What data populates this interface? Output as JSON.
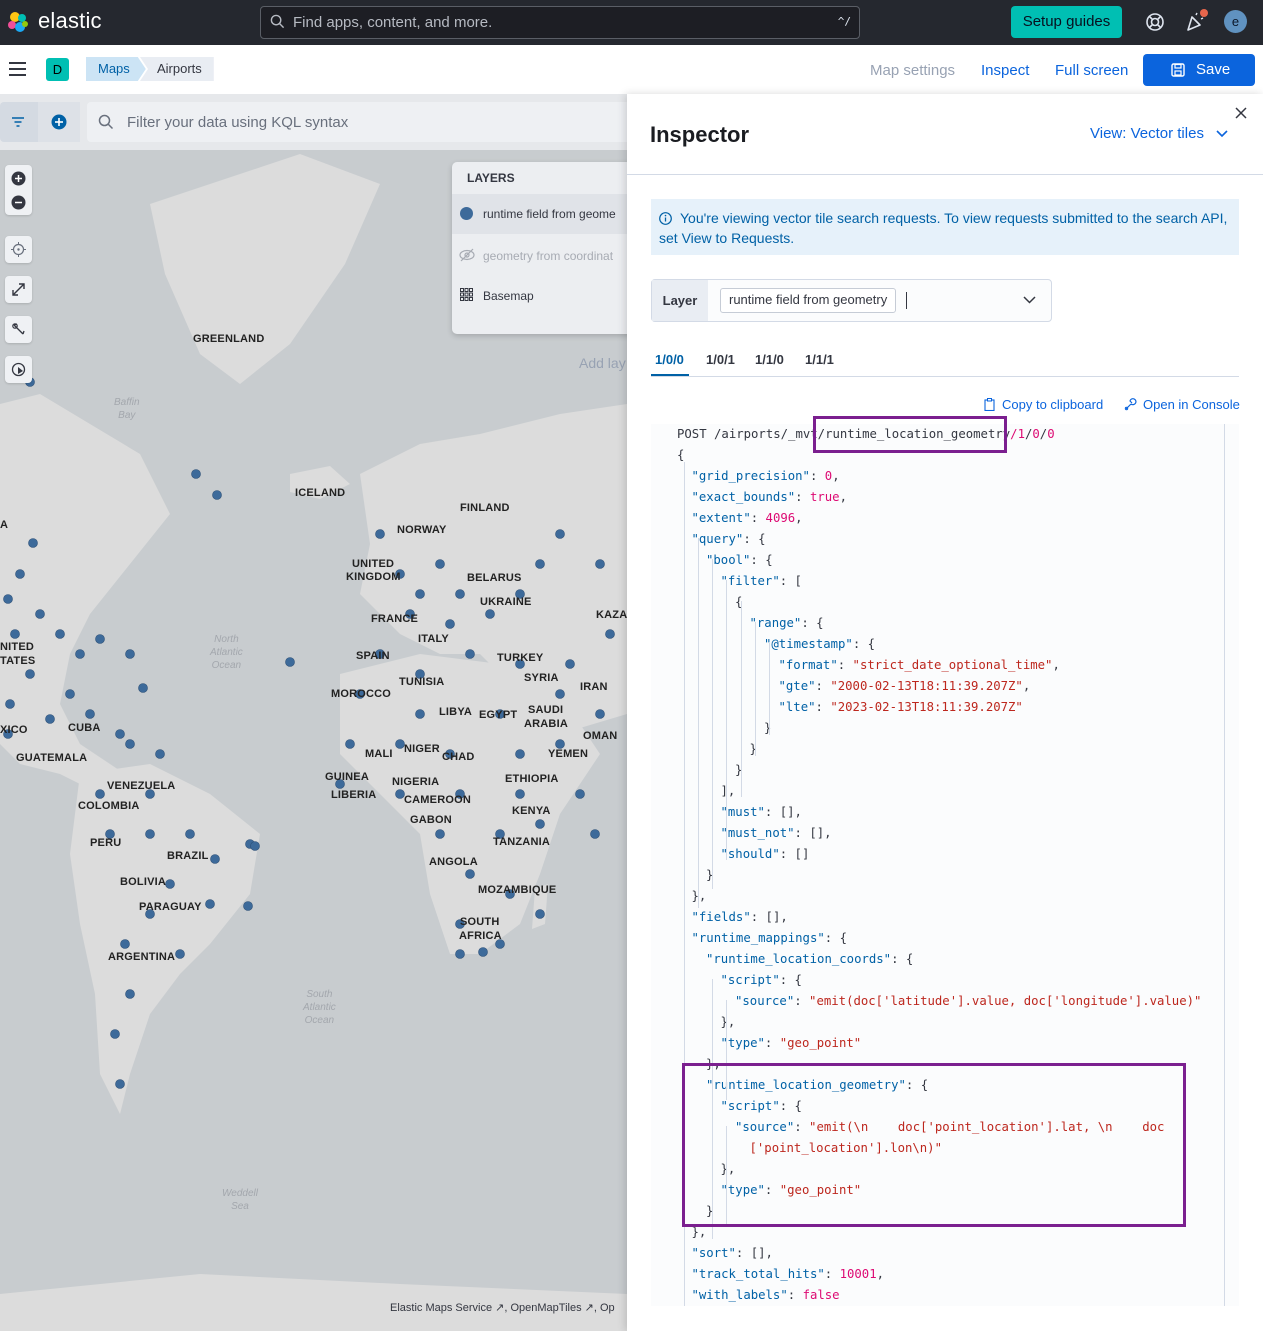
{
  "header": {
    "brand": "elastic",
    "search_placeholder": "Find apps, content, and more.",
    "search_shortcut": "^/",
    "setup_guides_label": "Setup guides",
    "avatar_initial": "e"
  },
  "appbar": {
    "space_initial": "D",
    "breadcrumbs": [
      "Maps",
      "Airports"
    ],
    "map_settings_label": "Map settings",
    "inspect_label": "Inspect",
    "full_screen_label": "Full screen",
    "save_label": "Save"
  },
  "map": {
    "kql_placeholder": "Filter your data using KQL syntax",
    "layers_title": "LAYERS",
    "layers": [
      {
        "label": "runtime field from geome",
        "icon": "circle-dot-icon"
      },
      {
        "label": "geometry from coordinat",
        "icon": "eye-closed-icon"
      },
      {
        "label": "Basemap",
        "icon": "grid-icon"
      }
    ],
    "add_layer_partial": "Add lay",
    "attribution": "Elastic Maps Service ↗, OpenMapTiles ↗, Op",
    "labels": {
      "greenland": "GREENLAND",
      "iceland": "ICELAND",
      "norway": "NORWAY",
      "finland": "FINLAND",
      "united": "UNITED",
      "kingdom": "KINGDOM",
      "belarus": "BELARUS",
      "ukraine": "UKRAINE",
      "france": "FRANCE",
      "italy": "ITALY",
      "kaza": "KAZA",
      "spain": "SPAIN",
      "turkey": "TURKEY",
      "tunisia": "TUNISIA",
      "syria": "SYRIA",
      "iran": "IRAN",
      "morocco": "MOROCCO",
      "libya": "LIBYA",
      "egypt": "EGYPT",
      "saudi": "SAUDI",
      "arabia": "ARABIA",
      "oman": "OMAN",
      "yemen": "YEMEN",
      "mali": "MALI",
      "niger": "NIGER",
      "chad": "CHAD",
      "guinea": "GUINEA",
      "nigeria": "NIGERIA",
      "ethiopia": "ETHIOPIA",
      "liberia": "LIBERIA",
      "cameroon": "CAMEROON",
      "kenya": "KENYA",
      "gabon": "GABON",
      "tanzania": "TANZANIA",
      "angola": "ANGOLA",
      "mozambique": "MOZAMBIQUE",
      "south": "SOUTH",
      "africa": "AFRICA",
      "venezuela": "VENEZUELA",
      "colombia": "COLOMBIA",
      "peru": "PERU",
      "brazil": "BRAZIL",
      "bolivia": "BOLIVIA",
      "paraguay": "PARAGUAY",
      "argentina": "ARGENTINA",
      "cuba": "CUBA",
      "guatemala": "GUATEMALA",
      "xico": "XICO",
      "nited": "NITED",
      "tates": "TATES",
      "a": "A"
    },
    "oceans": {
      "baffin": "Baffin\nBay",
      "north_atlantic": "North\nAtlantic\nOcean",
      "south_atlantic": "South\nAtlantic\nOcean",
      "weddell": "Weddell\nSea"
    }
  },
  "inspector": {
    "title": "Inspector",
    "view_label": "View: Vector tiles",
    "callout": "You're viewing vector tile search requests. To view requests submitted to the search API, set View to Requests.",
    "layer_label": "Layer",
    "layer_value": "runtime field from geometry",
    "tabs": [
      "1/0/0",
      "1/0/1",
      "1/1/0",
      "1/1/1"
    ],
    "copy_label": "Copy to clipboard",
    "console_label": "Open in Console",
    "request_line": {
      "method_path": "POST /airports/_mvt/",
      "field": "runtime_location_geometry",
      "tile": [
        "1",
        "0",
        "0"
      ]
    },
    "code_lines": [
      [
        [
          "p",
          "{"
        ]
      ],
      [
        [
          "k",
          "\"grid_precision\""
        ],
        [
          "p",
          ": "
        ],
        [
          "n",
          "0"
        ],
        [
          "p",
          ","
        ]
      ],
      [
        [
          "k",
          "\"exact_bounds\""
        ],
        [
          "p",
          ": "
        ],
        [
          "b",
          "true"
        ],
        [
          "p",
          ","
        ]
      ],
      [
        [
          "k",
          "\"extent\""
        ],
        [
          "p",
          ": "
        ],
        [
          "n",
          "4096"
        ],
        [
          "p",
          ","
        ]
      ],
      [
        [
          "k",
          "\"query\""
        ],
        [
          "p",
          ": {"
        ]
      ],
      [
        [
          "k",
          "\"bool\""
        ],
        [
          "p",
          ": {"
        ]
      ],
      [
        [
          "k",
          "\"filter\""
        ],
        [
          "p",
          ": ["
        ]
      ],
      [
        [
          "p",
          "{"
        ]
      ],
      [
        [
          "k",
          "\"range\""
        ],
        [
          "p",
          ": {"
        ]
      ],
      [
        [
          "k",
          "\"@timestamp\""
        ],
        [
          "p",
          ": {"
        ]
      ],
      [
        [
          "k",
          "\"format\""
        ],
        [
          "p",
          ": "
        ],
        [
          "s",
          "\"strict_date_optional_time\""
        ],
        [
          "p",
          ","
        ]
      ],
      [
        [
          "k",
          "\"gte\""
        ],
        [
          "p",
          ": "
        ],
        [
          "s",
          "\"2000-02-13T18:11:39.207Z\""
        ],
        [
          "p",
          ","
        ]
      ],
      [
        [
          "k",
          "\"lte\""
        ],
        [
          "p",
          ": "
        ],
        [
          "s",
          "\"2023-02-13T18:11:39.207Z\""
        ]
      ],
      [
        [
          "p",
          "}"
        ]
      ],
      [
        [
          "p",
          "}"
        ]
      ],
      [
        [
          "p",
          "}"
        ]
      ],
      [
        [
          "p",
          "],"
        ]
      ],
      [
        [
          "k",
          "\"must\""
        ],
        [
          "p",
          ": [],"
        ]
      ],
      [
        [
          "k",
          "\"must_not\""
        ],
        [
          "p",
          ": [],"
        ]
      ],
      [
        [
          "k",
          "\"should\""
        ],
        [
          "p",
          ": []"
        ]
      ],
      [
        [
          "p",
          "}"
        ]
      ],
      [
        [
          "p",
          "},"
        ]
      ],
      [
        [
          "k",
          "\"fields\""
        ],
        [
          "p",
          ": [],"
        ]
      ],
      [
        [
          "k",
          "\"runtime_mappings\""
        ],
        [
          "p",
          ": {"
        ]
      ],
      [
        [
          "k",
          "\"runtime_location_coords\""
        ],
        [
          "p",
          ": {"
        ]
      ],
      [
        [
          "k",
          "\"script\""
        ],
        [
          "p",
          ": {"
        ]
      ],
      [
        [
          "k",
          "\"source\""
        ],
        [
          "p",
          ": "
        ],
        [
          "s",
          "\"emit(doc['latitude'].value, doc['longitude'].value)\""
        ]
      ],
      [
        [
          "p",
          "},"
        ]
      ],
      [
        [
          "k",
          "\"type\""
        ],
        [
          "p",
          ": "
        ],
        [
          "s",
          "\"geo_point\""
        ]
      ],
      [
        [
          "p",
          "},"
        ]
      ],
      [
        [
          "k",
          "\"runtime_location_geometry\""
        ],
        [
          "p",
          ": {"
        ]
      ],
      [
        [
          "k",
          "\"script\""
        ],
        [
          "p",
          ": {"
        ]
      ],
      [
        [
          "k",
          "\"source\""
        ],
        [
          "p",
          ": "
        ],
        [
          "s",
          "\"emit(\\n    doc['point_location'].lat, \\n    doc"
        ]
      ],
      [
        [
          "s",
          "['point_location'].lon\\n)\""
        ]
      ],
      [
        [
          "p",
          "},"
        ]
      ],
      [
        [
          "k",
          "\"type\""
        ],
        [
          "p",
          ": "
        ],
        [
          "s",
          "\"geo_point\""
        ]
      ],
      [
        [
          "p",
          "}"
        ]
      ],
      [
        [
          "p",
          "},"
        ]
      ],
      [
        [
          "k",
          "\"sort\""
        ],
        [
          "p",
          ": [],"
        ]
      ],
      [
        [
          "k",
          "\"track_total_hits\""
        ],
        [
          "p",
          ": "
        ],
        [
          "n",
          "10001"
        ],
        [
          "p",
          ","
        ]
      ],
      [
        [
          "k",
          "\"with_labels\""
        ],
        [
          "p",
          ": "
        ],
        [
          "b",
          "false"
        ]
      ]
    ]
  },
  "colors": {
    "header_bg": "#25282f",
    "accent_teal": "#00bfb3",
    "primary_blue": "#0b64dd",
    "highlight_purple": "#7b1f8f",
    "map_point": "#3d6a9a"
  }
}
